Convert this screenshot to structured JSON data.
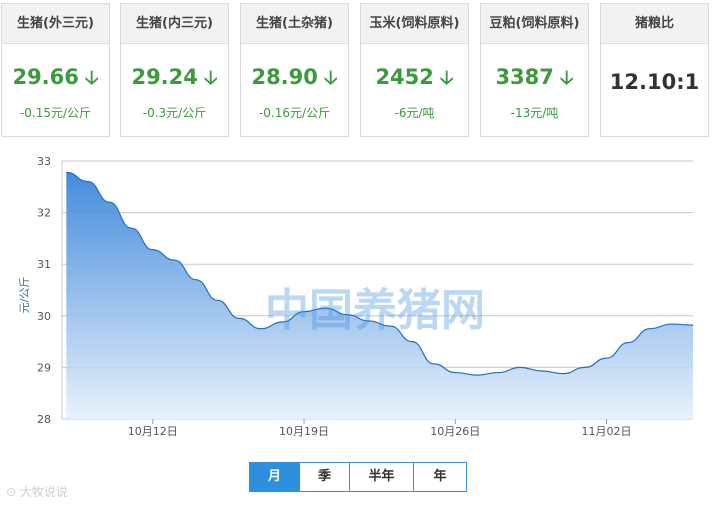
{
  "cards": [
    {
      "title": "生猪(外三元)",
      "price": "29.66",
      "change": "-0.15元/公斤",
      "trend": "down-arrow-icon"
    },
    {
      "title": "生猪(内三元)",
      "price": "29.24",
      "change": "-0.3元/公斤",
      "trend": "down-arrow-icon"
    },
    {
      "title": "生猪(土杂猪)",
      "price": "28.90",
      "change": "-0.16元/公斤",
      "trend": "down-arrow-icon"
    },
    {
      "title": "玉米(饲料原料)",
      "price": "2452",
      "change": "-6元/吨",
      "trend": "down-arrow-icon"
    },
    {
      "title": "豆粕(饲料原料)",
      "price": "3387",
      "change": "-13元/吨",
      "trend": "down-arrow-icon"
    }
  ],
  "ratio": {
    "title": "猪粮比",
    "value": "12.10:1"
  },
  "colors": {
    "down": "#3c9a3c",
    "area_top": "#2f7fd8",
    "area_bottom": "#e6f0fb",
    "active_button": "#2c8fe0"
  },
  "chart_data": {
    "type": "area",
    "ylabel": "元/公斤",
    "xlabel": "",
    "ylim": [
      28,
      33
    ],
    "yticks": [
      28,
      29,
      30,
      31,
      32,
      33
    ],
    "x_ticks": [
      {
        "day": 10,
        "label": "10月12日"
      },
      {
        "day": 17,
        "label": "10月19日"
      },
      {
        "day": 24,
        "label": "10月26日"
      },
      {
        "day": 31,
        "label": "11月02日"
      }
    ],
    "x_range": [
      5.8,
      35
    ],
    "grid": true,
    "watermark": "中国养猪网",
    "series": [
      {
        "x": [
          6,
          7,
          8,
          9,
          10,
          11,
          12,
          13,
          14,
          15,
          16,
          17,
          18,
          19,
          20,
          21,
          22,
          23,
          24,
          25,
          26,
          27,
          28,
          29,
          30,
          31,
          32,
          33,
          34,
          35
        ],
        "y": [
          32.78,
          32.6,
          32.2,
          31.7,
          31.28,
          31.08,
          30.7,
          30.3,
          29.95,
          29.75,
          29.88,
          30.08,
          30.15,
          30.02,
          29.9,
          29.8,
          29.5,
          29.07,
          28.9,
          28.85,
          28.9,
          29.0,
          28.93,
          28.88,
          29.0,
          29.18,
          29.48,
          29.75,
          29.84,
          29.82
        ]
      }
    ]
  },
  "range_buttons": [
    {
      "label": "月",
      "active": true
    },
    {
      "label": "季",
      "active": false
    },
    {
      "label": "半年",
      "active": false
    },
    {
      "label": "年",
      "active": false
    }
  ],
  "footer": {
    "watermark": "大牧说说"
  }
}
